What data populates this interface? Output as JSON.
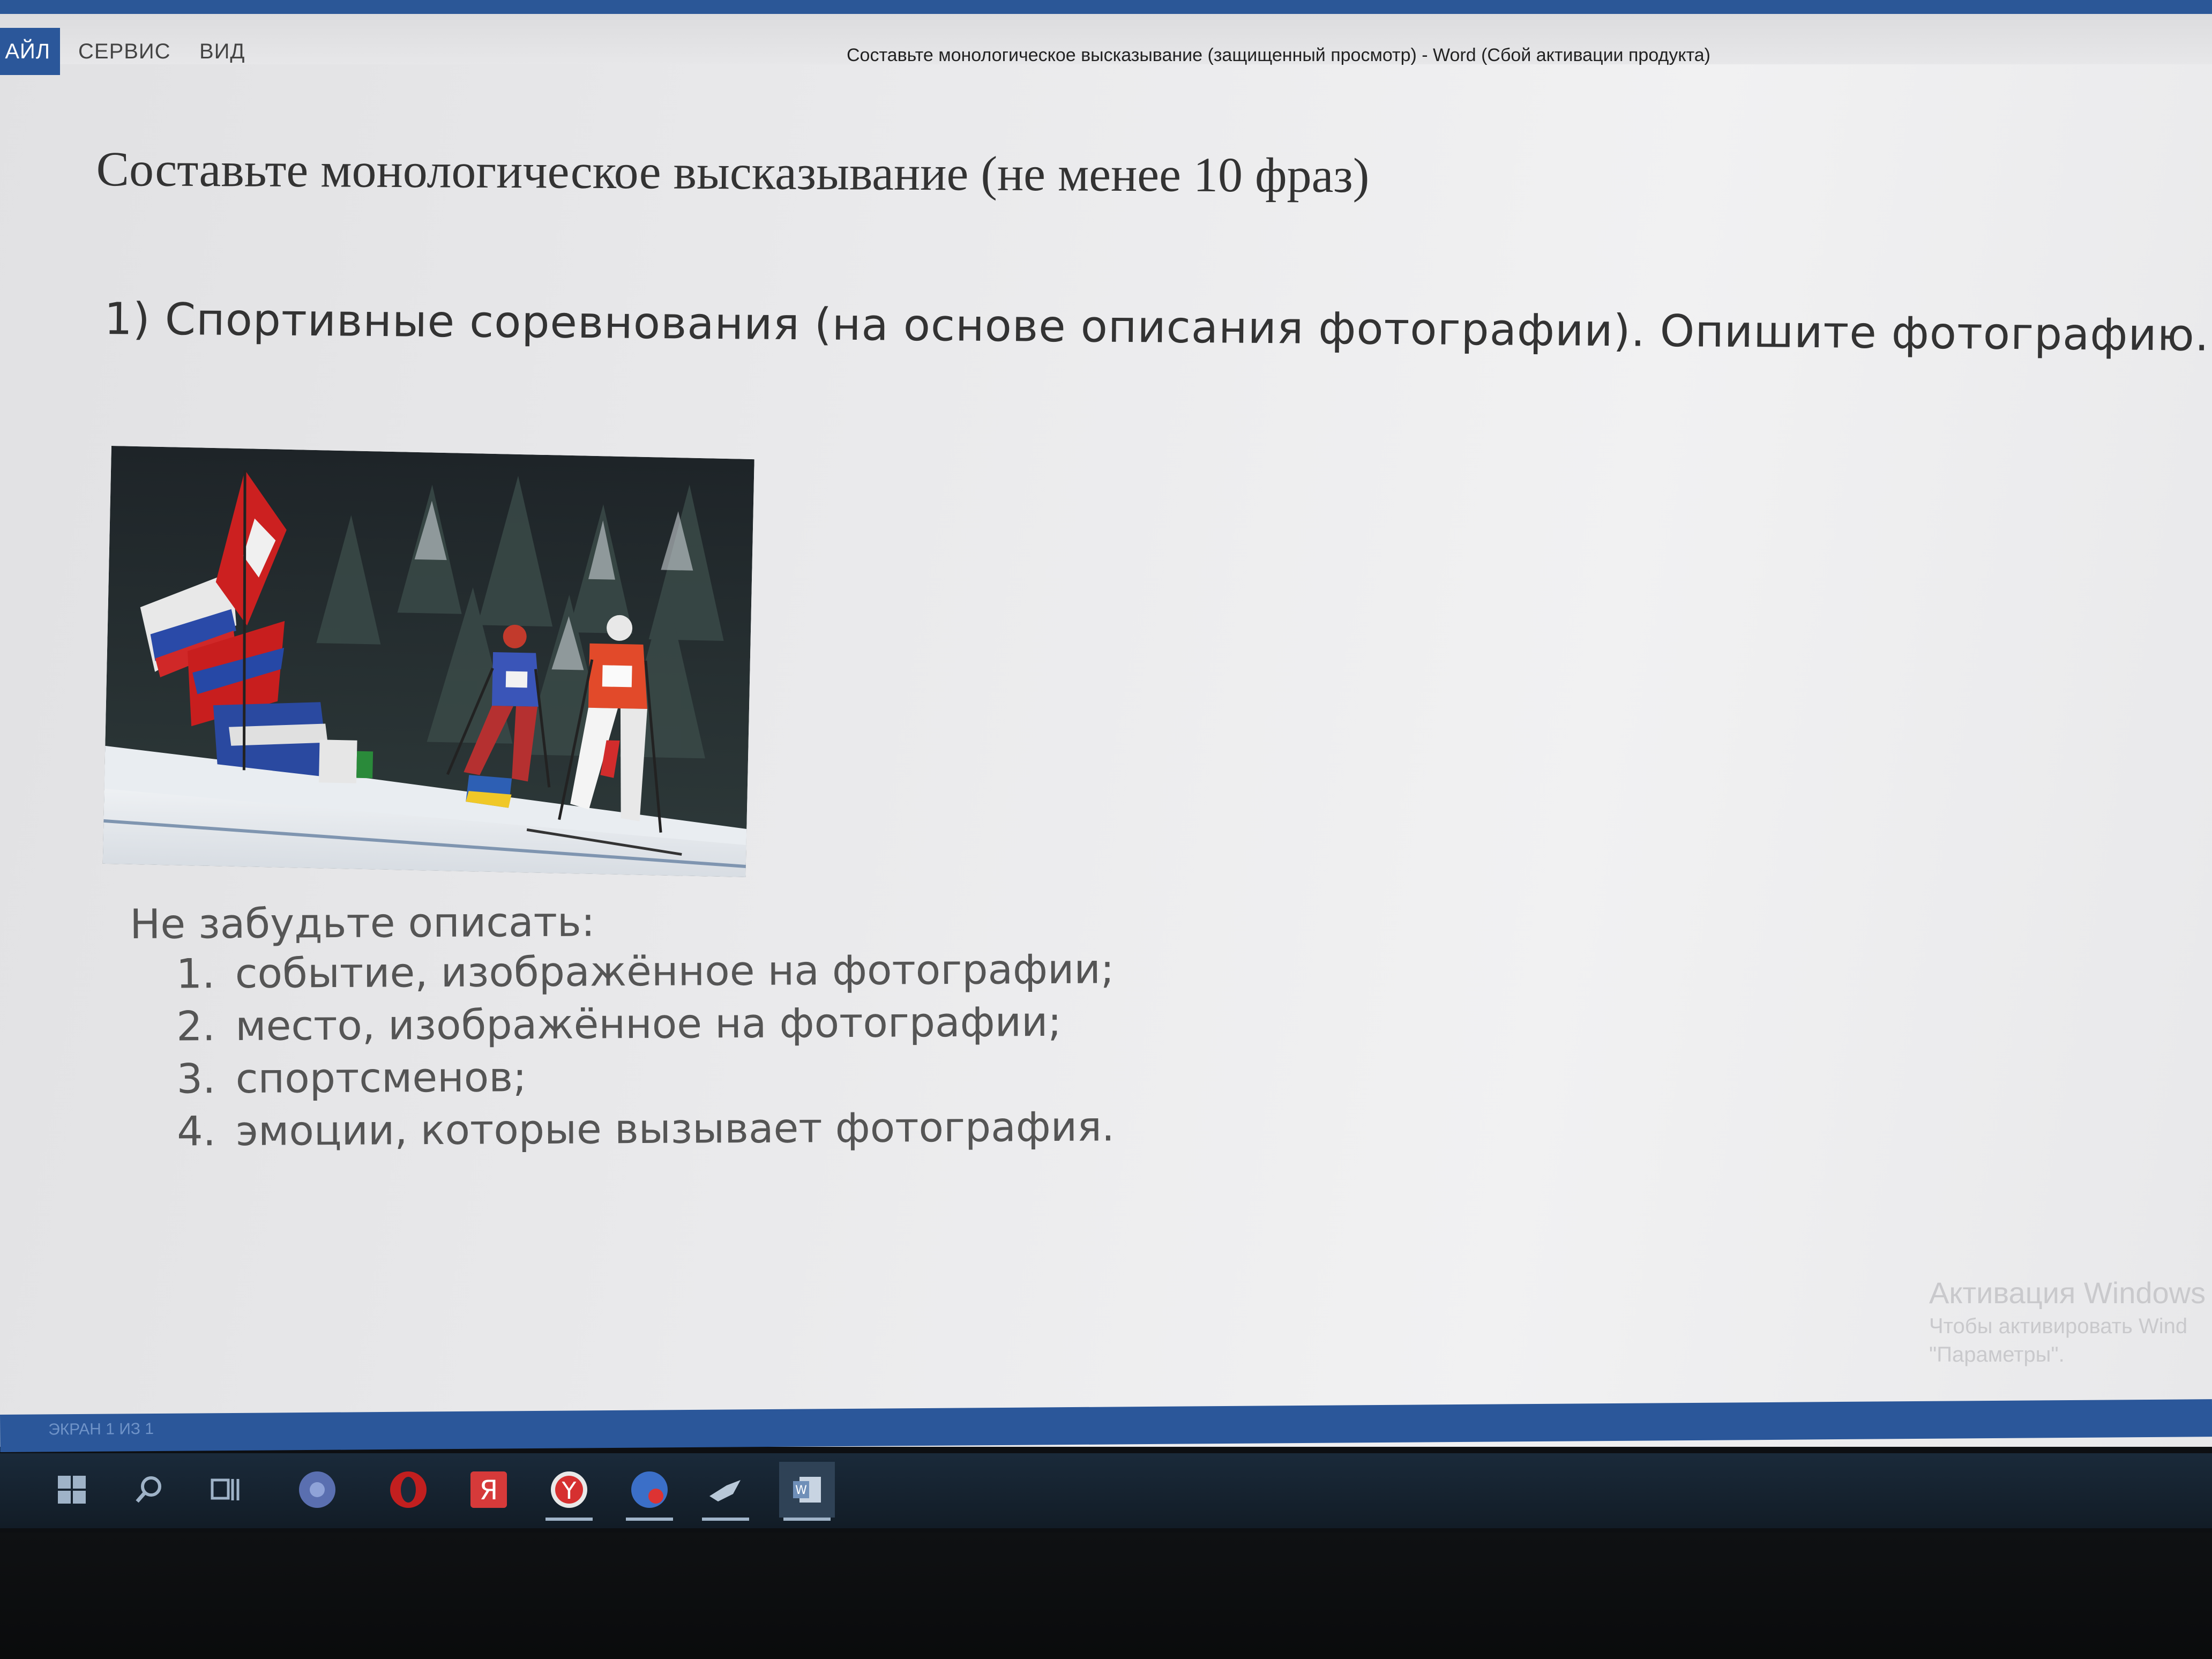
{
  "menubar": {
    "file_label": "АЙЛ",
    "service_label": "СЕРВИС",
    "view_label": "ВИД"
  },
  "window_title": "Составьте монологическое высказывание (защищенный просмотр) - Word (Сбой активации продукта)",
  "document": {
    "heading": "Составьте монологическое высказывание (не менее 10 фраз)",
    "task": "1) Спортивные соревнования (на основе описания фотографии). Опишите фотографию.",
    "reminder_title": "Не забудьте описать:",
    "reminder_items": [
      {
        "num": "1.",
        "text": "событие, изображённое на фотографии;"
      },
      {
        "num": "2.",
        "text": "место, изображённое на фотографии;"
      },
      {
        "num": "3.",
        "text": "спортсменов;"
      },
      {
        "num": "4.",
        "text": "эмоции, которые вызывает фотография."
      }
    ]
  },
  "watermark": {
    "line1": "Активация Windows",
    "line2": "Чтобы активировать Wind",
    "line3": "\"Параметры\"."
  },
  "statusbar": {
    "page_info": "ЭКРАН 1 ИЗ 1"
  },
  "taskbar": {
    "icons": [
      "windows-start-icon",
      "search-icon",
      "task-view-icon",
      "chrome-icon",
      "opera-icon",
      "yandex-icon",
      "yandex-browser-icon",
      "vpn-icon",
      "steam-icon",
      "word-icon"
    ]
  },
  "colors": {
    "word_blue": "#2b579a",
    "screen_bg": "#e9e9eb",
    "text": "#333333"
  }
}
